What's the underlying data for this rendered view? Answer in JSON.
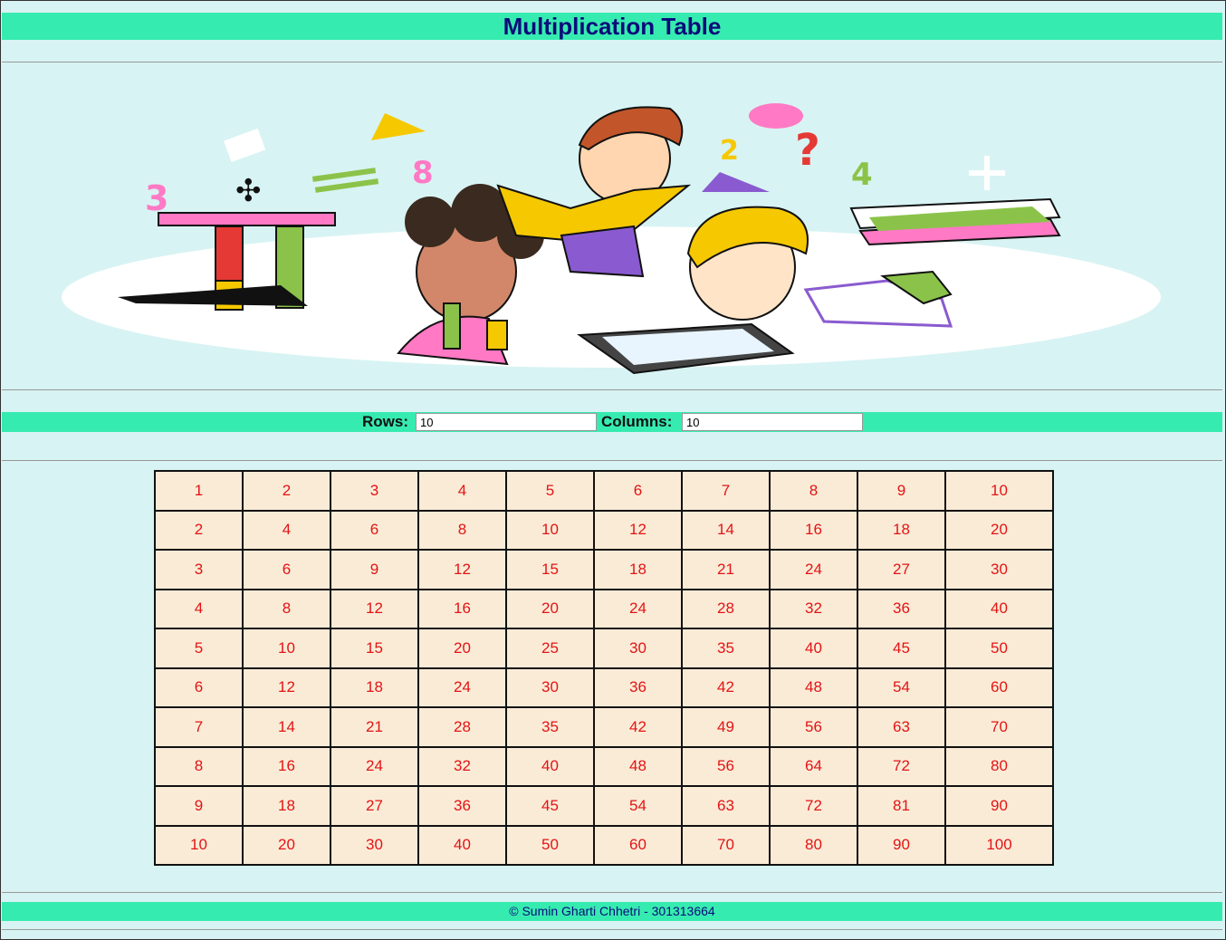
{
  "page": {
    "title": "Multiplication Table"
  },
  "controls": {
    "rows_label": "Rows:",
    "rows_value": "10",
    "columns_label": "Columns:",
    "columns_value": "10"
  },
  "table": {
    "rows": [
      [
        "1",
        "2",
        "3",
        "4",
        "5",
        "6",
        "7",
        "8",
        "9",
        "10"
      ],
      [
        "2",
        "4",
        "6",
        "8",
        "10",
        "12",
        "14",
        "16",
        "18",
        "20"
      ],
      [
        "3",
        "6",
        "9",
        "12",
        "15",
        "18",
        "21",
        "24",
        "27",
        "30"
      ],
      [
        "4",
        "8",
        "12",
        "16",
        "20",
        "24",
        "28",
        "32",
        "36",
        "40"
      ],
      [
        "5",
        "10",
        "15",
        "20",
        "25",
        "30",
        "35",
        "40",
        "45",
        "50"
      ],
      [
        "6",
        "12",
        "18",
        "24",
        "30",
        "36",
        "42",
        "48",
        "54",
        "60"
      ],
      [
        "7",
        "14",
        "21",
        "28",
        "35",
        "42",
        "49",
        "56",
        "63",
        "70"
      ],
      [
        "8",
        "16",
        "24",
        "32",
        "40",
        "48",
        "56",
        "64",
        "72",
        "80"
      ],
      [
        "9",
        "18",
        "27",
        "36",
        "45",
        "54",
        "63",
        "72",
        "81",
        "90"
      ],
      [
        "10",
        "20",
        "30",
        "40",
        "50",
        "60",
        "70",
        "80",
        "90",
        "100"
      ]
    ]
  },
  "illustration": {
    "symbols": [
      "3",
      "8",
      "2",
      "?",
      "4",
      "+",
      "="
    ]
  },
  "footer": {
    "text": "© Sumin Gharti Chhetri - 301313664"
  },
  "colors": {
    "background": "#d8f3f3",
    "accent_bar": "#36ebb0",
    "title_text": "#0b0b7a",
    "cell_background": "#faebd7",
    "cell_text": "#e31414"
  }
}
